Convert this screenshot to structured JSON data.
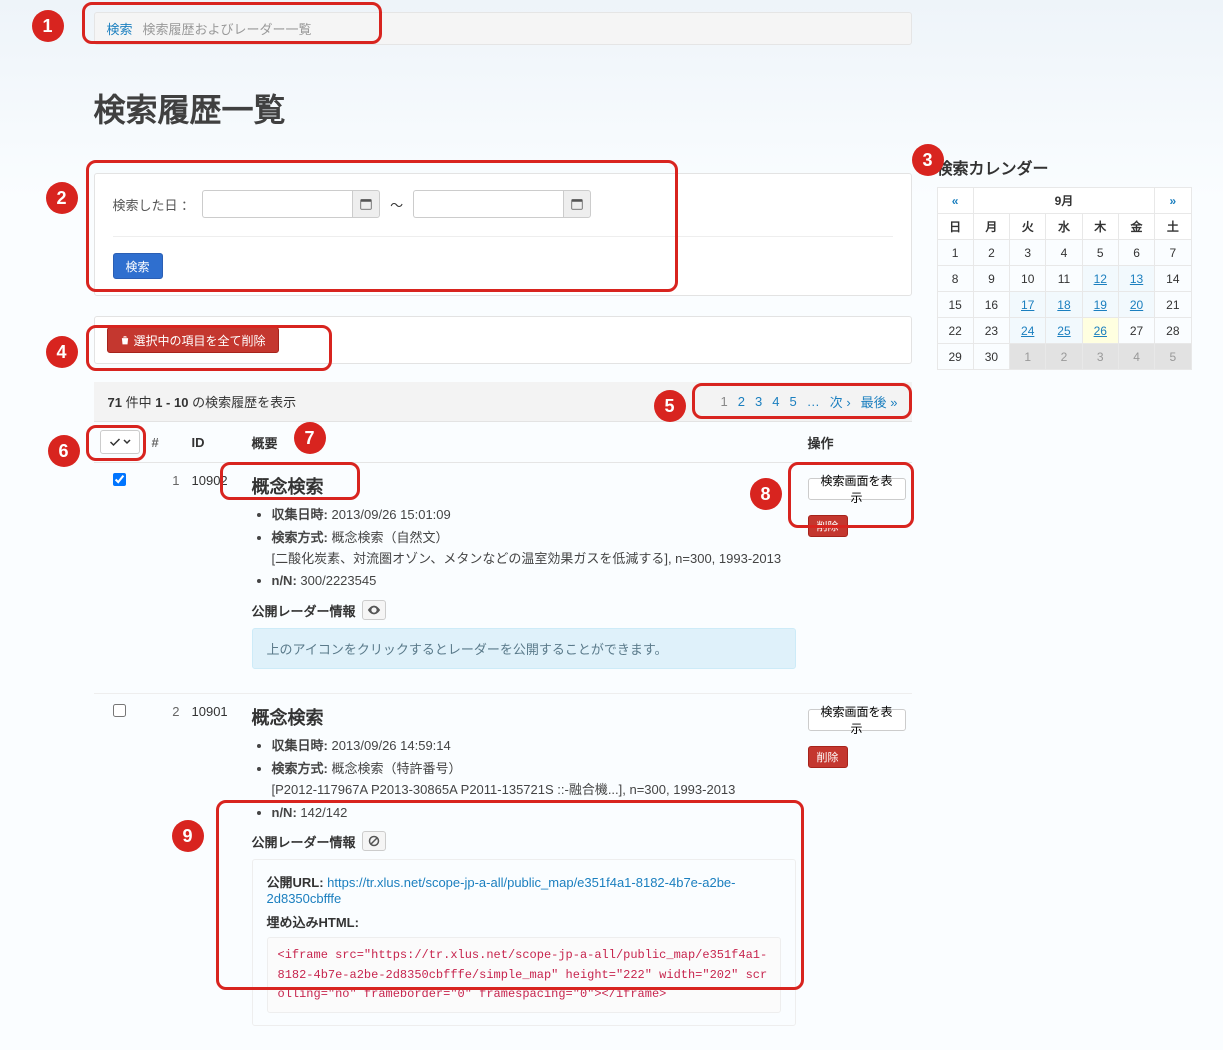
{
  "breadcrumb": {
    "root": "検索",
    "current": "検索履歴およびレーダー一覧"
  },
  "page_title": "検索履歴一覧",
  "filter": {
    "label": "検索した日 ：",
    "from": "",
    "to": "",
    "submit": "検索"
  },
  "bulk_delete_label": "選択中の項目を全て削除",
  "result_summary": {
    "total": "71",
    "range": "1 - 10",
    "suffix": " の検索履歴を表示"
  },
  "pagination": {
    "pages": [
      "1",
      "2",
      "3",
      "4",
      "5"
    ],
    "current": "1",
    "ellipsis": "…",
    "next": "次 ›",
    "last": "最後 »"
  },
  "table": {
    "headers": {
      "idx": "#",
      "id": "ID",
      "summary": "概要",
      "ops": "操作"
    }
  },
  "ops": {
    "show": "検索画面を表示",
    "delete": "削除"
  },
  "rows": [
    {
      "idx": "1",
      "id": "10902",
      "checked": true,
      "title": "概念検索",
      "collected_at_label": "収集日時:",
      "collected_at": "2013/09/26 15:01:09",
      "method_label": "検索方式:",
      "method": "概念検索（自然文）",
      "query": "[二酸化炭素、対流圏オゾン、メタンなどの温室効果ガスを低減する], n=300, 1993-2013",
      "nn_label": "n/N:",
      "nn": "300/2223545",
      "radar_heading": "公開レーダー情報",
      "radar_info_msg": "上のアイコンをクリックするとレーダーを公開することができます。"
    },
    {
      "idx": "2",
      "id": "10901",
      "checked": false,
      "title": "概念検索",
      "collected_at_label": "収集日時:",
      "collected_at": "2013/09/26 14:59:14",
      "method_label": "検索方式:",
      "method": "概念検索（特許番号）",
      "query": "[P2012-117967A P2013-30865A P2011-135721S ::-融合機...], n=300, 1993-2013",
      "nn_label": "n/N:",
      "nn": "142/142",
      "radar_heading": "公開レーダー情報",
      "public_url_label": "公開URL:",
      "public_url": "https://tr.xlus.net/scope-jp-a-all/public_map/e351f4a1-8182-4b7e-a2be-2d8350cbfffe",
      "embed_label": "埋め込みHTML:",
      "embed_html": "<iframe src=\"https://tr.xlus.net/scope-jp-a-all/public_map/e351f4a1-8182-4b7e-a2be-2d8350cbfffe/simple_map\" height=\"222\" width=\"202\" scrolling=\"no\" frameborder=\"0\" framespacing=\"0\"></iframe>"
    }
  ],
  "calendar": {
    "title": "検索カレンダー",
    "prev": "«",
    "next": "»",
    "month": "9月",
    "dow": [
      "日",
      "月",
      "火",
      "水",
      "木",
      "金",
      "土"
    ],
    "weeks": [
      [
        {
          "d": "1"
        },
        {
          "d": "2"
        },
        {
          "d": "3"
        },
        {
          "d": "4"
        },
        {
          "d": "5"
        },
        {
          "d": "6"
        },
        {
          "d": "7"
        }
      ],
      [
        {
          "d": "8"
        },
        {
          "d": "9"
        },
        {
          "d": "10"
        },
        {
          "d": "11"
        },
        {
          "d": "12",
          "link": true
        },
        {
          "d": "13",
          "link": true
        },
        {
          "d": "14"
        }
      ],
      [
        {
          "d": "15"
        },
        {
          "d": "16"
        },
        {
          "d": "17",
          "link": true
        },
        {
          "d": "18",
          "link": true
        },
        {
          "d": "19",
          "link": true
        },
        {
          "d": "20",
          "link": true
        },
        {
          "d": "21"
        }
      ],
      [
        {
          "d": "22"
        },
        {
          "d": "23"
        },
        {
          "d": "24",
          "link": true
        },
        {
          "d": "25",
          "link": true
        },
        {
          "d": "26",
          "link": true,
          "today": true
        },
        {
          "d": "27"
        },
        {
          "d": "28"
        }
      ],
      [
        {
          "d": "29"
        },
        {
          "d": "30"
        },
        {
          "d": "1",
          "other": true
        },
        {
          "d": "2",
          "other": true
        },
        {
          "d": "3",
          "other": true
        },
        {
          "d": "4",
          "other": true
        },
        {
          "d": "5",
          "other": true
        }
      ]
    ]
  },
  "annotations": [
    "1",
    "2",
    "3",
    "4",
    "5",
    "6",
    "7",
    "8",
    "9"
  ]
}
